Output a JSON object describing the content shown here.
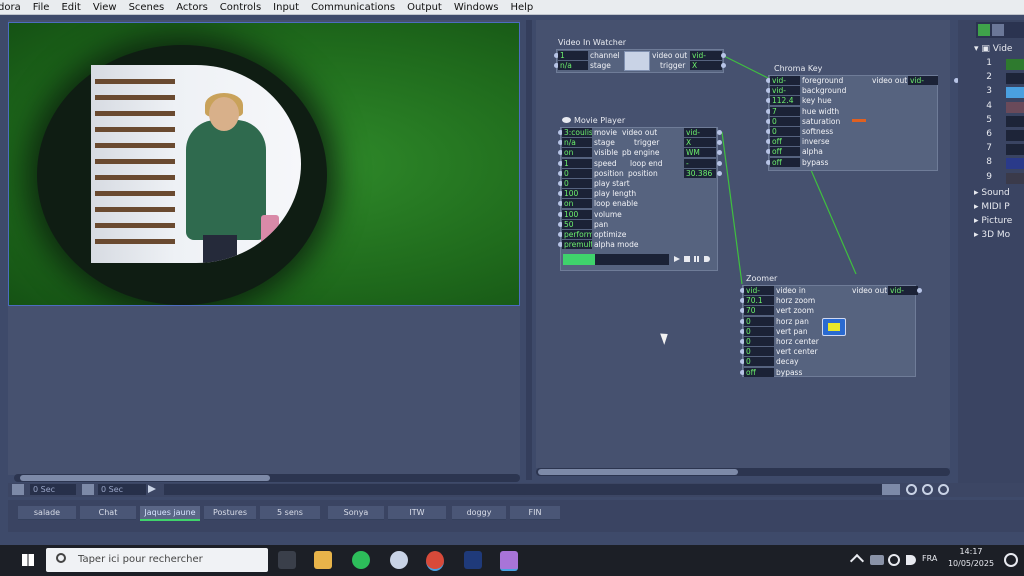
{
  "menu": [
    "dora",
    "File",
    "Edit",
    "View",
    "Scenes",
    "Actors",
    "Controls",
    "Input",
    "Communications",
    "Output",
    "Windows",
    "Help"
  ],
  "actors": {
    "video_in_watcher": {
      "title": "Video In Watcher",
      "inputs": [
        {
          "value": "1",
          "label": "channel"
        },
        {
          "value": "n/a",
          "label": "stage"
        }
      ],
      "outputs": [
        {
          "label": "video out",
          "value": "vid-gpu"
        },
        {
          "label": "trigger",
          "value": "X"
        }
      ]
    },
    "movie_player": {
      "title": "Movie Player",
      "inputs": [
        {
          "value": "3:coulis",
          "label": "movie"
        },
        {
          "value": "n/a",
          "label": "stage"
        },
        {
          "value": "on",
          "label": "visible"
        },
        {
          "value": "1",
          "label": "speed"
        },
        {
          "value": "0",
          "label": "position"
        },
        {
          "value": "0",
          "label": "play start"
        },
        {
          "value": "100",
          "label": "play length"
        },
        {
          "value": "on",
          "label": "loop enable"
        },
        {
          "value": "100",
          "label": "volume"
        },
        {
          "value": "50",
          "label": "pan"
        },
        {
          "value": "perform",
          "label": "optimize"
        },
        {
          "value": "premult",
          "label": "alpha mode"
        }
      ],
      "outputs": [
        {
          "label": "video out",
          "value": "vid-gpu"
        },
        {
          "label": "trigger",
          "value": "X"
        },
        {
          "label": "pb engine",
          "value": "WM"
        },
        {
          "label": "loop end",
          "value": "-"
        },
        {
          "label": "position",
          "value": "30.386"
        }
      ],
      "progress": 0.3
    },
    "chroma_key": {
      "title": "Chroma Key",
      "inputs": [
        {
          "value": "vid-gpu",
          "label": "foreground"
        },
        {
          "value": "vid-gpu",
          "label": "background"
        },
        {
          "value": "112.4",
          "label": "key hue"
        },
        {
          "value": "7",
          "label": "hue width"
        },
        {
          "value": "0",
          "label": "saturation"
        },
        {
          "value": "0",
          "label": "softness"
        },
        {
          "value": "off",
          "label": "inverse"
        },
        {
          "value": "off",
          "label": "alpha"
        },
        {
          "value": "off",
          "label": "bypass"
        }
      ],
      "outputs": [
        {
          "label": "video out",
          "value": "vid-gpu"
        }
      ]
    },
    "zoomer": {
      "title": "Zoomer",
      "inputs": [
        {
          "value": "vid-gpu",
          "label": "video in"
        },
        {
          "value": "70.1",
          "label": "horz zoom"
        },
        {
          "value": "70",
          "label": "vert zoom"
        },
        {
          "value": "0",
          "label": "horz pan"
        },
        {
          "value": "0",
          "label": "vert pan"
        },
        {
          "value": "0",
          "label": "horz center"
        },
        {
          "value": "0",
          "label": "vert center"
        },
        {
          "value": "0",
          "label": "decay"
        },
        {
          "value": "off",
          "label": "bypass"
        }
      ],
      "outputs": [
        {
          "label": "video out",
          "value": "vid-gpu"
        }
      ]
    }
  },
  "sidebar": {
    "header_label": "Vide",
    "items": [
      "1",
      "2",
      "3",
      "4",
      "5",
      "6",
      "7",
      "8",
      "9"
    ],
    "groups": [
      "Sound",
      "MIDI P",
      "Picture",
      "3D Mo"
    ]
  },
  "timebar": {
    "time1": "0 Sec",
    "time2": "0 Sec"
  },
  "scenes": [
    {
      "label": "salade",
      "active": false
    },
    {
      "label": "Chat",
      "active": false
    },
    {
      "label": "Jaques jaune",
      "active": true
    },
    {
      "label": "Postures",
      "active": false
    },
    {
      "label": "5 sens",
      "active": false
    },
    {
      "label": "Sonya",
      "active": false
    },
    {
      "label": "ITW",
      "active": false
    },
    {
      "label": "doggy",
      "active": false
    },
    {
      "label": "FIN",
      "active": false
    }
  ],
  "taskbar": {
    "search_placeholder": "Taper ici pour rechercher",
    "language": "FRA",
    "time": "14:17",
    "date": "10/05/2025"
  },
  "colors": {
    "accent": "#3fd36c",
    "value_text": "#6cf06c",
    "wire": "#3fbf3f"
  }
}
